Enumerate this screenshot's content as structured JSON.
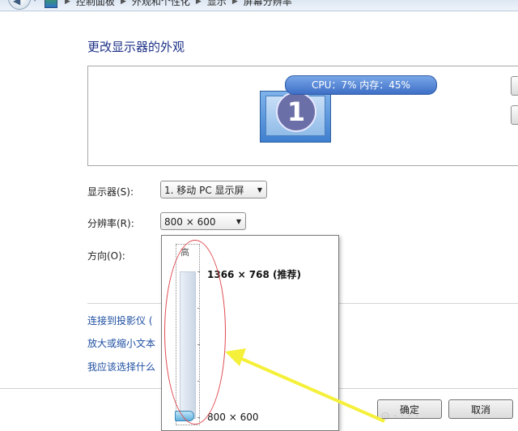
{
  "breadcrumb": {
    "items": [
      "控制面板",
      "外观和个性化",
      "显示",
      "屏幕分辨率"
    ]
  },
  "page": {
    "title": "更改显示器的外观"
  },
  "preview": {
    "monitor_number": "1",
    "cpu_overlay": "CPU：7%   内存：45%"
  },
  "settings": {
    "display_label": "显示器(S):",
    "display_value": "1. 移动 PC 显示屏",
    "resolution_label": "分辨率(R):",
    "resolution_value": "800 × 600",
    "orientation_label": "方向(O):"
  },
  "resolution_dropdown": {
    "high_label": "高",
    "options": [
      {
        "label": "1366 × 768 (推荐)",
        "recommended": true
      },
      {
        "label": "800 × 600",
        "selected": true
      }
    ]
  },
  "links": {
    "projector": "连接到投影仪 (",
    "text_size": "放大或缩小文本",
    "what_settings": "我应该选择什么"
  },
  "buttons": {
    "ok": "确定",
    "cancel": "取消"
  },
  "colors": {
    "heading": "#1e3287",
    "link": "#1e4fa1",
    "annotation_red": "#e0484f",
    "annotation_yellow": "#f5f03a"
  }
}
